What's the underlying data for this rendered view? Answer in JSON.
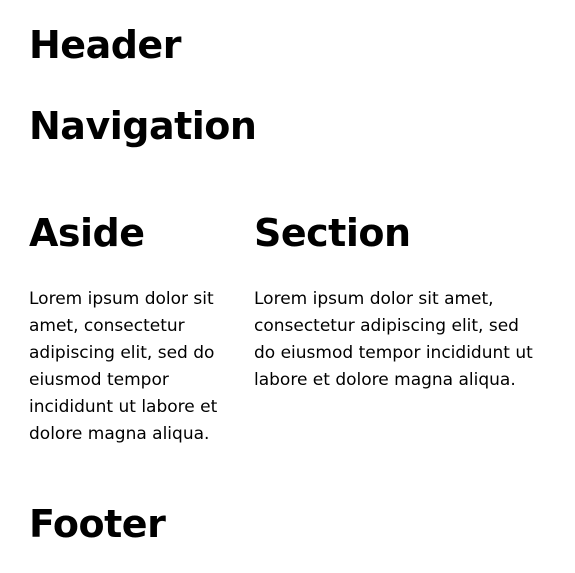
{
  "header": {
    "title": "Header"
  },
  "navigation": {
    "title": "Navigation"
  },
  "aside": {
    "title": "Aside",
    "text": "Lorem ipsum dolor sit amet, consectetur adipiscing elit, sed do eiusmod tempor incididunt ut labore et dolore magna aliqua."
  },
  "section": {
    "title": "Section",
    "text": "Lorem ipsum dolor sit amet, consectetur adipiscing elit, sed do eiusmod tempor incididunt ut labore et dolore magna aliqua."
  },
  "footer": {
    "title": "Footer"
  }
}
